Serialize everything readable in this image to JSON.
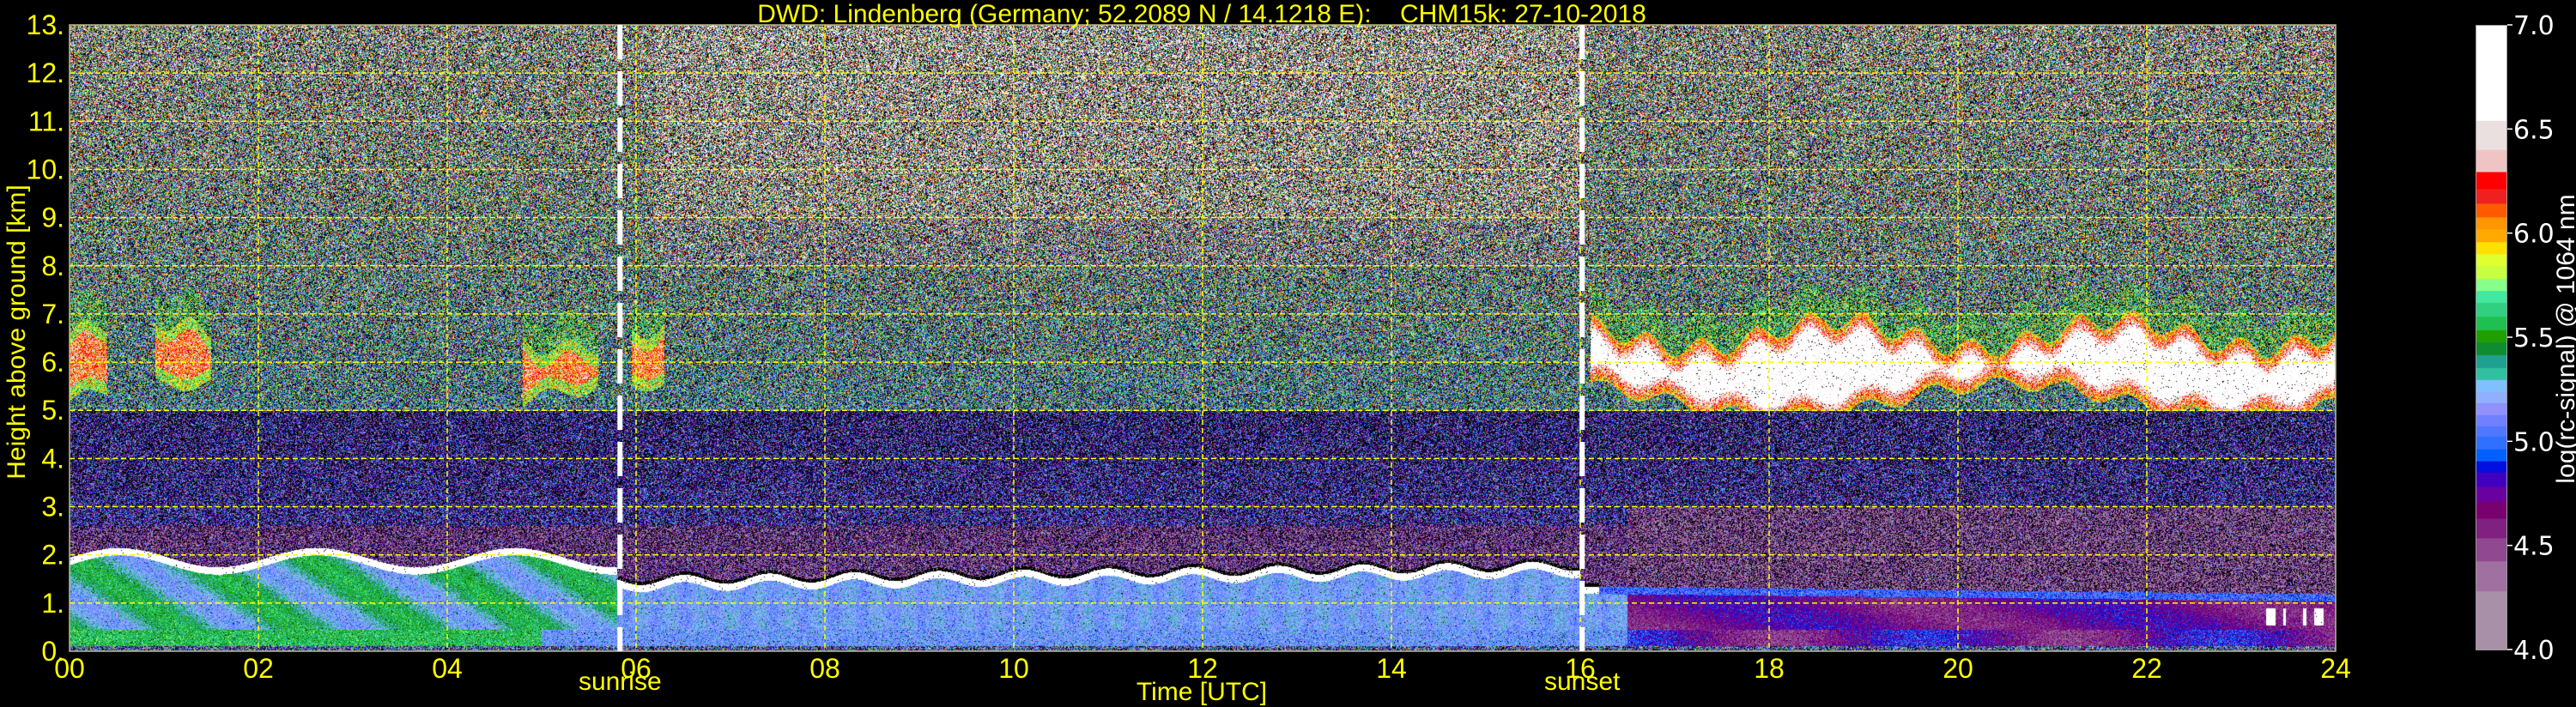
{
  "chart_data": {
    "type": "heatmap",
    "title": "DWD: Lindenberg (Germany; 52.2089 N / 14.1218 E):    CHM15k: 27-10-2018",
    "xlabel": "Time [UTC]",
    "ylabel": "Height above ground [km]",
    "xlim": [
      0,
      24
    ],
    "ylim": [
      0,
      13
    ],
    "x_ticks": [
      0,
      2,
      4,
      6,
      8,
      10,
      12,
      14,
      16,
      18,
      20,
      22,
      24
    ],
    "x_tick_labels": [
      "00",
      "02",
      "04",
      "06",
      "08",
      "10",
      "12",
      "14",
      "16",
      "18",
      "20",
      "22",
      "24"
    ],
    "y_ticks": [
      0,
      1,
      2,
      3,
      4,
      5,
      6,
      7,
      8,
      9,
      10,
      11,
      12,
      13
    ],
    "y_tick_labels": [
      "0.",
      "1.",
      "2.",
      "3.",
      "4.",
      "5.",
      "6.",
      "7.",
      "8.",
      "9.",
      "10.",
      "11.",
      "12.",
      "13."
    ],
    "grid": true,
    "grid_color": "#ffff00",
    "annotations": [
      {
        "label": "sunrise",
        "time": 5.83
      },
      {
        "label": "sunset",
        "time": 16.02
      }
    ],
    "colorbar": {
      "label": "log(rc-signal) @ 1064 nm",
      "range": [
        4.0,
        7.0
      ],
      "ticks": [
        4.0,
        4.5,
        5.0,
        5.5,
        6.0,
        6.5,
        7.0
      ],
      "tick_labels": [
        "4.0",
        "4.5",
        "5.0",
        "5.5",
        "6.0",
        "6.5",
        "7.0"
      ],
      "bands": [
        {
          "from": 4.0,
          "color": "#a890a8"
        },
        {
          "from": 4.277,
          "color": "#a070a0"
        },
        {
          "from": 4.422,
          "color": "#904890"
        },
        {
          "from": 4.532,
          "color": "#802080"
        },
        {
          "from": 4.627,
          "color": "#780070"
        },
        {
          "from": 4.709,
          "color": "#6a00a0"
        },
        {
          "from": 4.78,
          "color": "#4000c0"
        },
        {
          "from": 4.85,
          "color": "#0010e0"
        },
        {
          "from": 4.904,
          "color": "#0060ff"
        },
        {
          "from": 4.964,
          "color": "#3070ff"
        },
        {
          "from": 5.022,
          "color": "#5078ff"
        },
        {
          "from": 5.072,
          "color": "#7080ff"
        },
        {
          "from": 5.126,
          "color": "#9090ff"
        },
        {
          "from": 5.185,
          "color": "#90b0ff"
        },
        {
          "from": 5.239,
          "color": "#80c0ff"
        },
        {
          "from": 5.297,
          "color": "#30c0a0"
        },
        {
          "from": 5.355,
          "color": "#20a090"
        },
        {
          "from": 5.416,
          "color": "#108c30"
        },
        {
          "from": 5.476,
          "color": "#20a000"
        },
        {
          "from": 5.535,
          "color": "#20c050"
        },
        {
          "from": 5.6,
          "color": "#30d080"
        },
        {
          "from": 5.667,
          "color": "#40e8a0"
        },
        {
          "from": 5.725,
          "color": "#88ff88"
        },
        {
          "from": 5.783,
          "color": "#c8ff40"
        },
        {
          "from": 5.844,
          "color": "#e0ff30"
        },
        {
          "from": 5.902,
          "color": "#ffe000"
        },
        {
          "from": 5.958,
          "color": "#ffaa00"
        },
        {
          "from": 6.021,
          "color": "#ff9600"
        },
        {
          "from": 6.077,
          "color": "#ff5a00"
        },
        {
          "from": 6.146,
          "color": "#f02020"
        },
        {
          "from": 6.215,
          "color": "#ff0000"
        },
        {
          "from": 6.298,
          "color": "#f0c4c4"
        },
        {
          "from": 6.406,
          "color": "#ebe0e0"
        },
        {
          "from": 6.546,
          "color": "#ffffff"
        }
      ]
    },
    "features": [
      {
        "name": "cirrus",
        "time": [
          16.0,
          24.0
        ],
        "height_km": [
          4.9,
          7.3
        ]
      },
      {
        "name": "cirrus-patches",
        "time": [
          0.0,
          5.8
        ],
        "height_km": [
          5.3,
          7.3
        ]
      },
      {
        "name": "boundary-layer-top",
        "time": [
          0.0,
          16.0
        ],
        "height_km": [
          1.0,
          2.2
        ]
      },
      {
        "name": "low-cloud",
        "time": [
          23.2,
          24.0
        ],
        "height_km": [
          0.5,
          1.0
        ]
      }
    ]
  }
}
